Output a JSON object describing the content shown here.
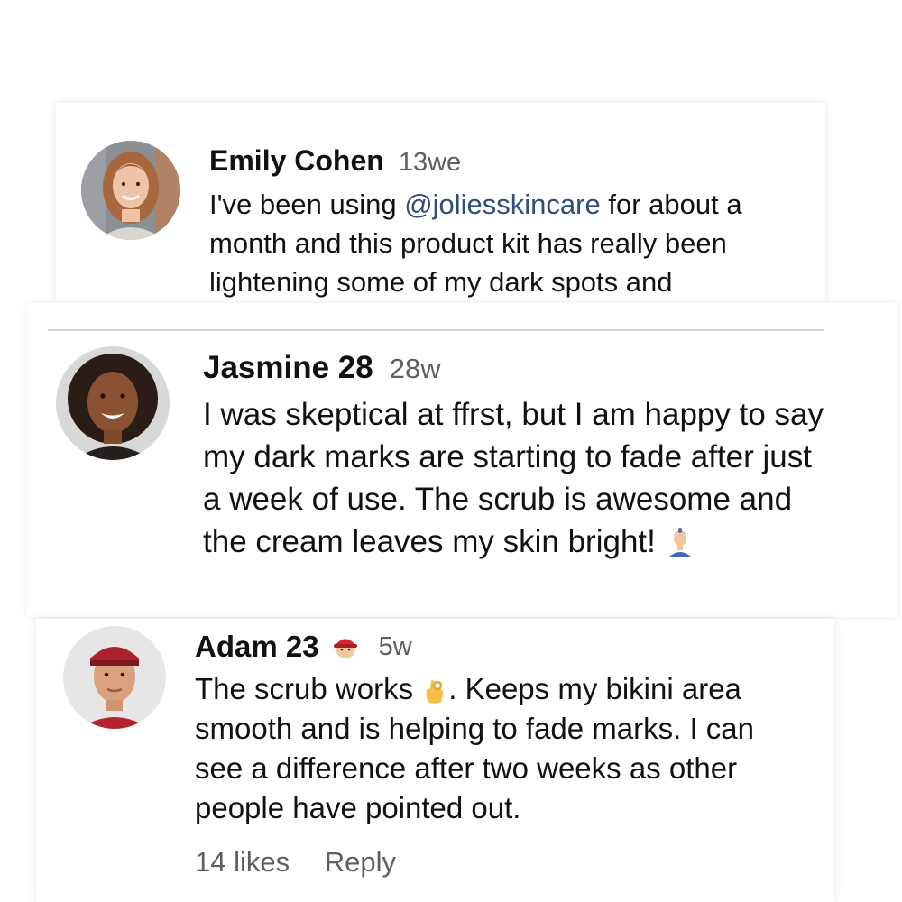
{
  "comments": [
    {
      "author": "Emily Cohen",
      "age": "13we",
      "text_prefix": "I've been using ",
      "mention": "@joliesskincare",
      "text_suffix": " for about a month and this product kit has really been lightening some of my dark spots and",
      "avatar_icon": "woman-avatar-photo"
    },
    {
      "author": "Jasmine 28",
      "age": "28w",
      "text": "I was skeptical at ffrst, but I am happy to say my dark marks are starting to fade after just a week of use. The scrub is awesome and the cream leaves my skin bright!",
      "emoji": "person-emoji",
      "avatar_icon": "woman-avatar-photo"
    },
    {
      "author": "Adam 23",
      "age": "5w",
      "author_emoji": "red-cap-emoji",
      "text_prefix": "The scrub works ",
      "text_emoji": "ok-hand-emoji",
      "text_suffix": ". Keeps my bikini area smooth and is helping to fade marks. I can see a difference after two weeks as other people have pointed out.",
      "likes": "14 likes",
      "reply": "Reply",
      "avatar_icon": "man-avatar-photo"
    }
  ],
  "colors": {
    "mention": "#2e4d7a",
    "secondary_text": "#5f5f5f",
    "primary_text": "#111111",
    "divider": "#d4d4d4"
  }
}
